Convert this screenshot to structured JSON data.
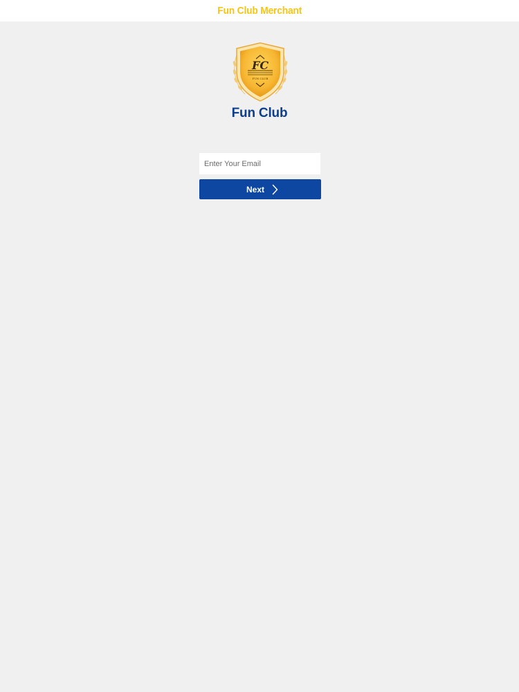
{
  "app_bar": {
    "title": "Fun Club Merchant"
  },
  "logo": {
    "monogram": "FC",
    "small_text": "FUN CLUB"
  },
  "brand": {
    "name": "Fun Club"
  },
  "login_form": {
    "email_placeholder": "Enter Your Email",
    "email_value": "",
    "next_label": "Next"
  },
  "colors": {
    "title_yellow": "#f5c518",
    "brand_blue": "#0d3f8a",
    "button_blue": "#0d47a1",
    "background": "#f0f0f1",
    "shield_gold": "#f7b733"
  },
  "icons": {
    "next_button": "chevron-right-icon",
    "logo": "shield-badge-icon"
  }
}
